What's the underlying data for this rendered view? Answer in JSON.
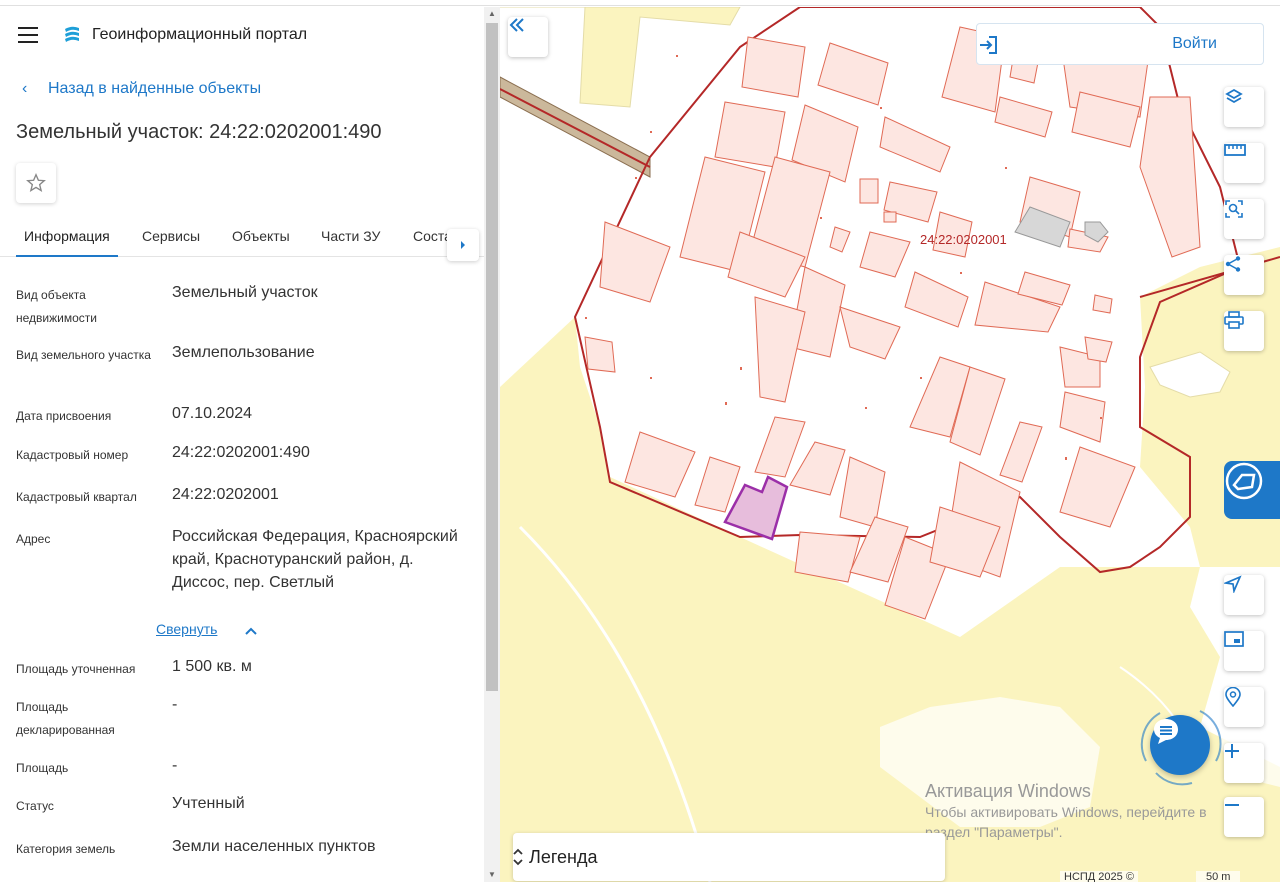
{
  "app": {
    "title": "Геоинформационный портал"
  },
  "nav": {
    "back_label": "Назад в найденные объекты"
  },
  "object": {
    "title": "Земельный участок: 24:22:0202001:490"
  },
  "tabs": [
    {
      "label": "Информация"
    },
    {
      "label": "Сервисы"
    },
    {
      "label": "Объекты"
    },
    {
      "label": "Части ЗУ"
    },
    {
      "label": "Соста"
    }
  ],
  "info": {
    "rows": [
      {
        "key": "Вид объекта недвижимости",
        "value": "Земельный участок"
      },
      {
        "key": "Вид земельного участка",
        "value": "Землепользование"
      },
      {
        "key": "Дата присвоения",
        "value": "07.10.2024"
      },
      {
        "key": "Кадастровый номер",
        "value": "24:22:0202001:490"
      },
      {
        "key": "Кадастровый квартал",
        "value": "24:22:0202001"
      },
      {
        "key": "Адрес",
        "value": "Российская Федерация, Красноярский край, Краснотуранский район, д. Диссос, пер. Светлый"
      },
      {
        "key": "Площадь уточненная",
        "value": "1 500 кв. м"
      },
      {
        "key": "Площадь декларированная",
        "value": "-"
      },
      {
        "key": "Площадь",
        "value": "-"
      },
      {
        "key": "Статус",
        "value": "Учтенный"
      },
      {
        "key": "Категория земель",
        "value": "Земли населенных пунктов"
      }
    ],
    "collapse_label": "Свернуть"
  },
  "map": {
    "login_label": "Войти",
    "quarter_label": "24:22:0202001",
    "legend_label": "Легенда",
    "copyright": "НСПД 2025 ©",
    "scale_label": "50 m",
    "watermark_title": "Активация Windows",
    "watermark_sub": "Чтобы активировать Windows, перейдите в раздел \"Параметры\"."
  },
  "colors": {
    "accent": "#1e78c8",
    "parcel_stroke": "#e06a55",
    "parcel_fill": "#fde6e1",
    "selected": "#9b2fa8",
    "land": "#fbf4bf"
  }
}
